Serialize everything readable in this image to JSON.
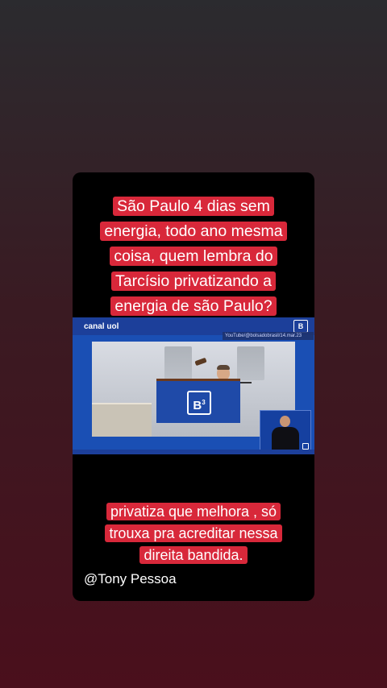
{
  "post": {
    "caption_top_lines": [
      "São Paulo 4 dias sem",
      "energia, todo ano mesma",
      "coisa, quem lembra do",
      "Tarcísio privatizando a",
      "energia de são Paulo?"
    ],
    "caption_bottom_lines": [
      "privatiza que melhora , só",
      "trouxa pra acreditar nessa",
      "direita bandida."
    ],
    "handle": "@Tony Pessoa"
  },
  "video": {
    "channel_logo": "canal uol",
    "b3_logo": "[B]³",
    "source_credit": "YouTube/@bolsadobrasil/14.mar.23"
  },
  "colors": {
    "highlight": "#d8283a",
    "video_blue": "#1a4fb4",
    "card_bg": "#000000"
  }
}
